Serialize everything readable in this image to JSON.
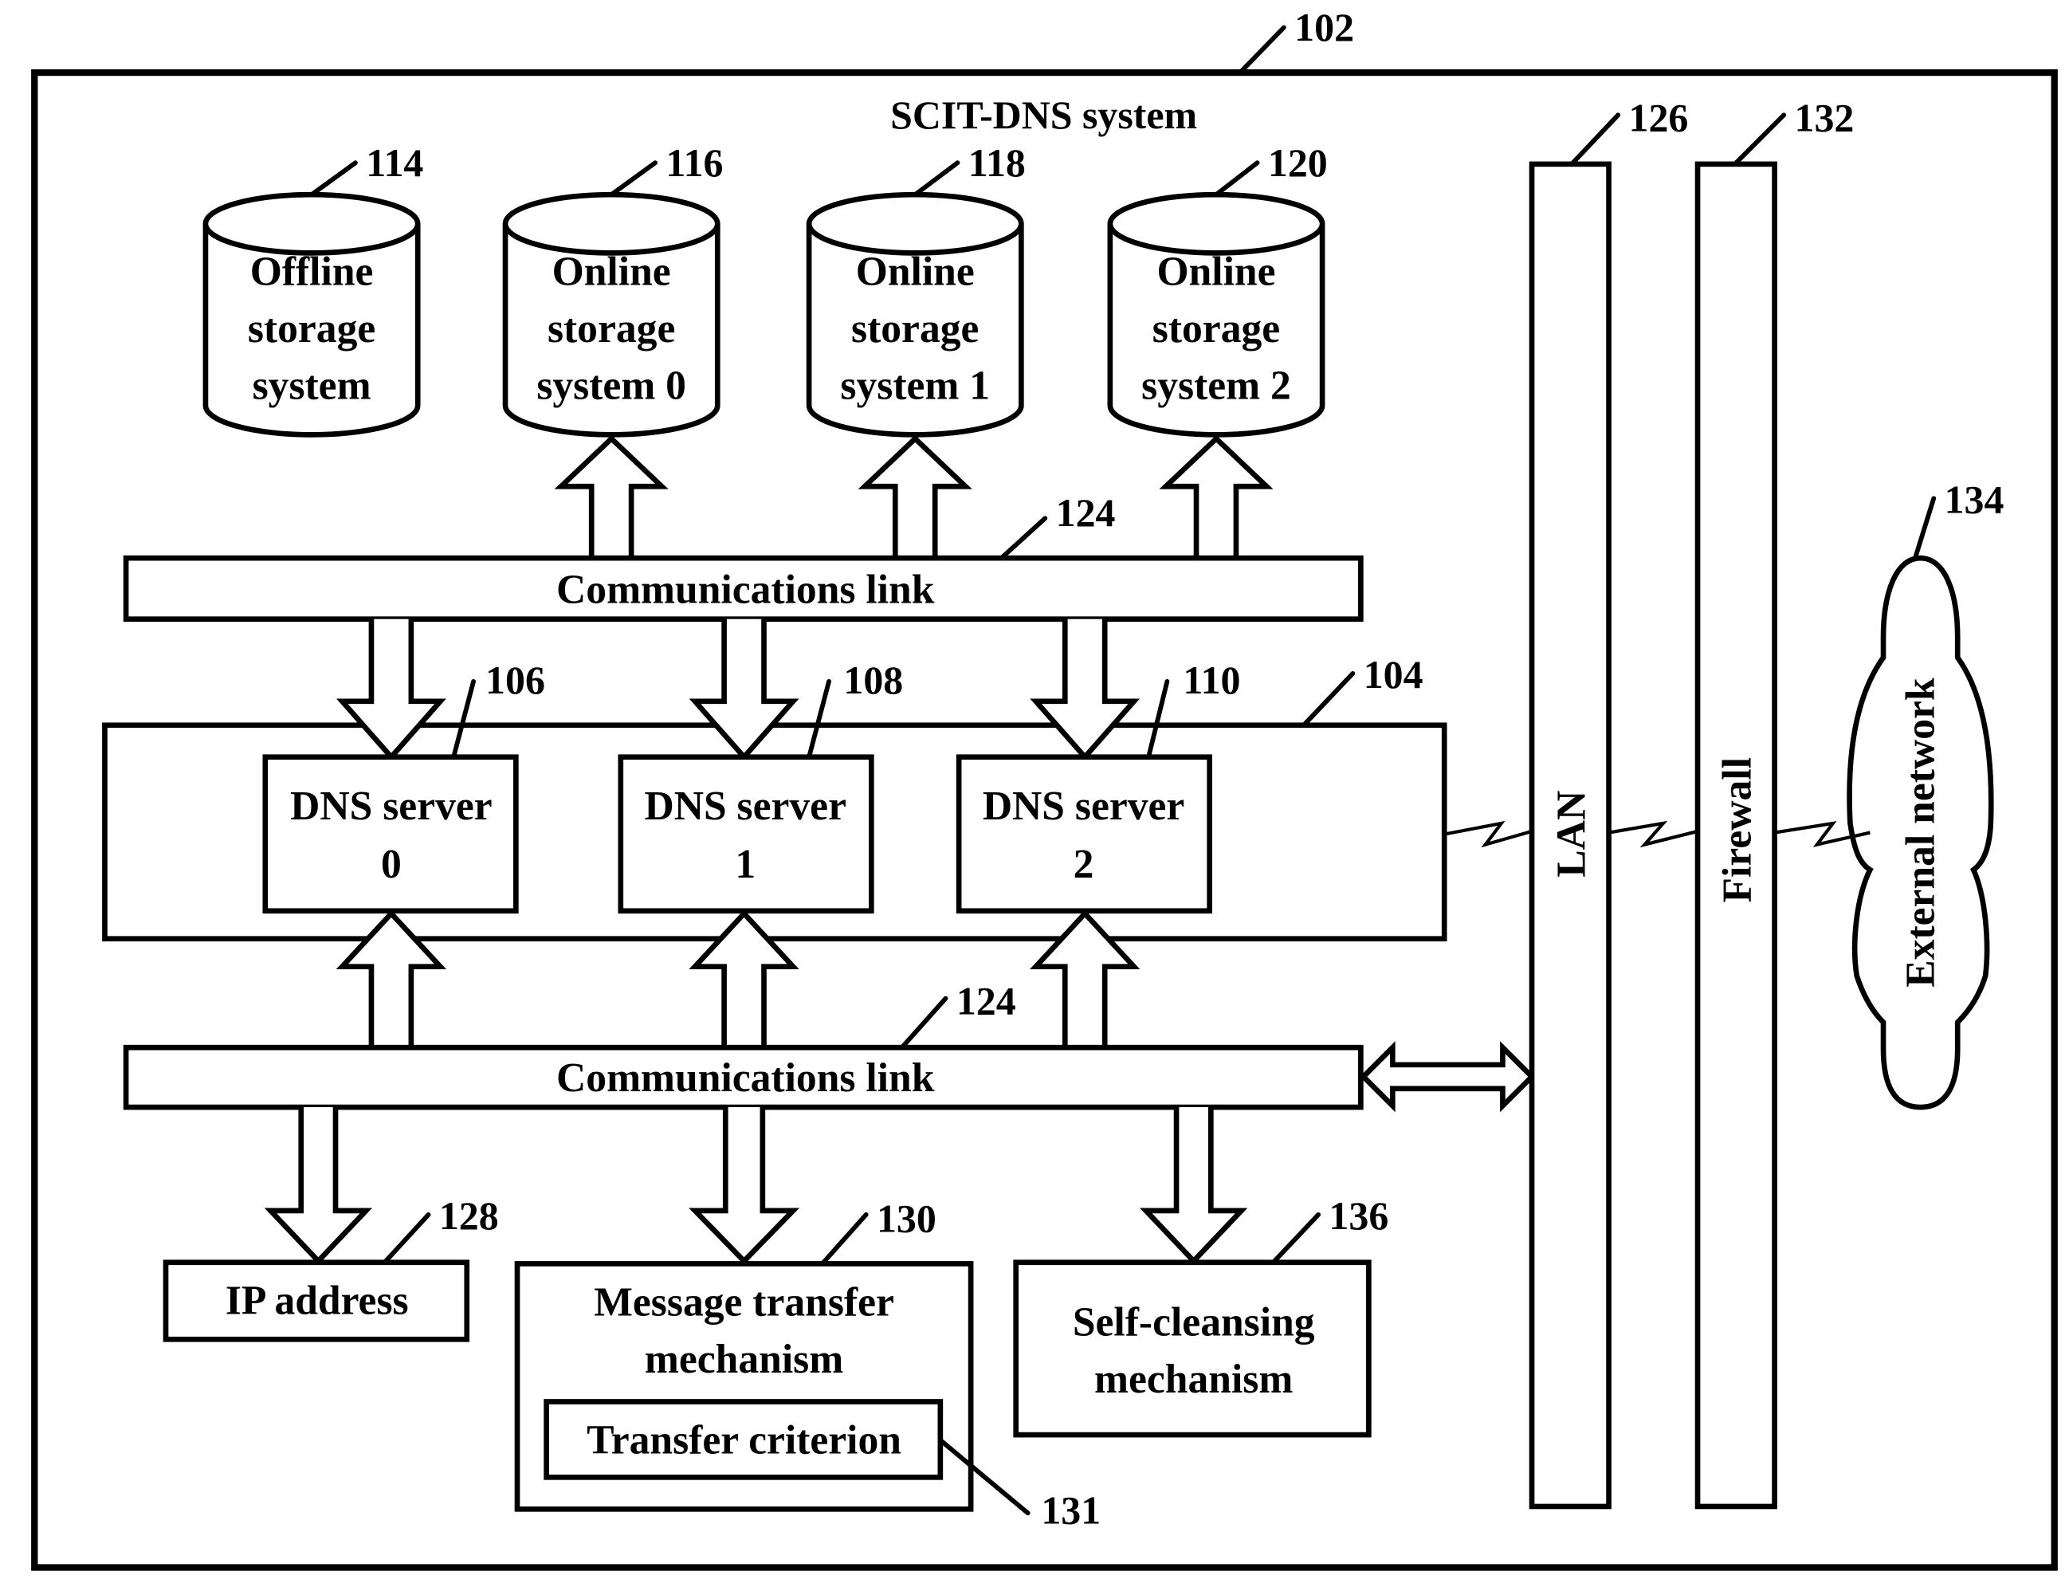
{
  "title": "SCIT-DNS system",
  "refs": {
    "system": "102",
    "server_group": "104",
    "server0": "106",
    "server1": "108",
    "server2": "110",
    "offline_storage": "114",
    "online_storage0": "116",
    "online_storage1": "118",
    "online_storage2": "120",
    "comm_link_top": "124",
    "comm_link_bottom": "124",
    "lan": "126",
    "ip_address": "128",
    "message_transfer": "130",
    "transfer_criterion": "131",
    "firewall": "132",
    "external_network": "134",
    "self_cleansing": "136"
  },
  "storage": [
    {
      "lines": [
        "Offline",
        "storage",
        "system"
      ]
    },
    {
      "lines": [
        "Online",
        "storage",
        "system 0"
      ]
    },
    {
      "lines": [
        "Online",
        "storage",
        "system 1"
      ]
    },
    {
      "lines": [
        "Online",
        "storage",
        "system 2"
      ]
    }
  ],
  "comm_link_label": "Communications link",
  "servers": [
    {
      "line1": "DNS server",
      "line2": "0"
    },
    {
      "line1": "DNS server",
      "line2": "1"
    },
    {
      "line1": "DNS server",
      "line2": "2"
    }
  ],
  "lan_label": "LAN",
  "firewall_label": "Firewall",
  "external_network_label": "External network",
  "ip_address_label": "IP address",
  "message_transfer_lines": [
    "Message transfer",
    "mechanism"
  ],
  "transfer_criterion_label": "Transfer criterion",
  "self_cleansing_lines": [
    "Self-cleansing",
    "mechanism"
  ]
}
